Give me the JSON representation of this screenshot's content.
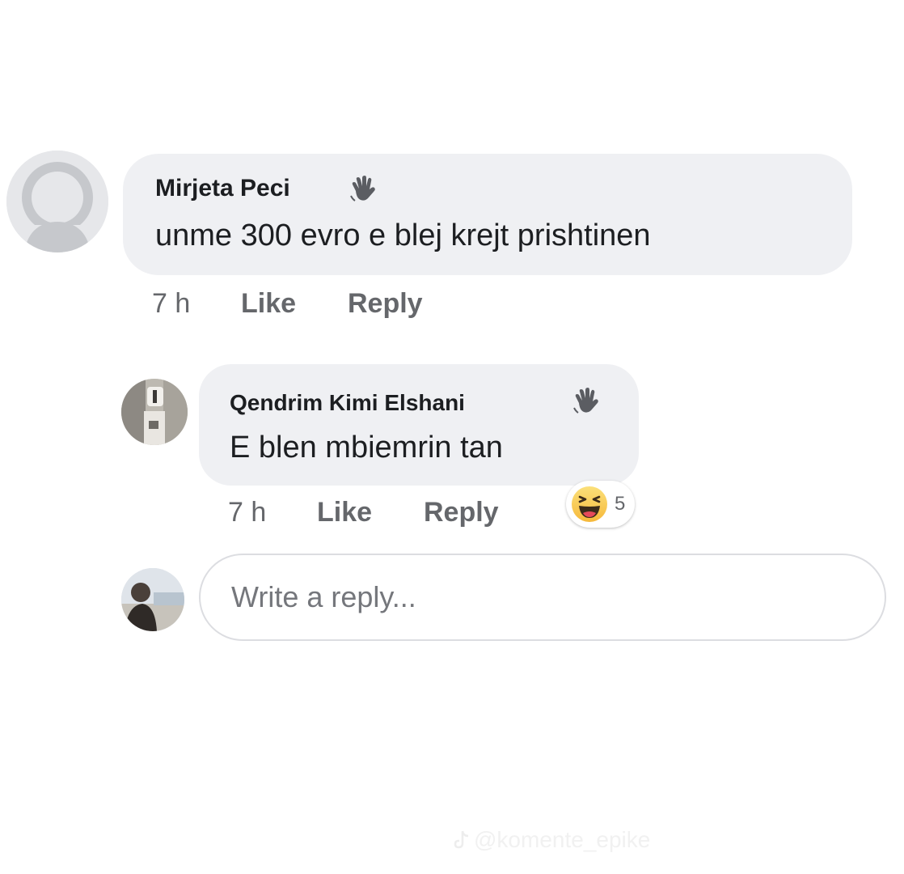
{
  "comments": [
    {
      "author": "Mirjeta Peci",
      "text": "unme 300 evro e blej krejt prishtinen",
      "time": "7 h",
      "like_label": "Like",
      "reply_label": "Reply",
      "badge_icon": "waving-hand-icon"
    },
    {
      "author": "Qendrim Kimi Elshani",
      "text": "E blen mbiemrin tan",
      "time": "7 h",
      "like_label": "Like",
      "reply_label": "Reply",
      "badge_icon": "waving-hand-icon",
      "reaction": {
        "icon": "haha-emoji-icon",
        "count": "5"
      }
    }
  ],
  "composer": {
    "placeholder": "Write a reply..."
  },
  "watermark": {
    "icon": "tiktok-icon",
    "text": "@komente_epike"
  },
  "colors": {
    "bubble": "#eff0f3",
    "meta_text": "#65676b",
    "main_text": "#1c1e21"
  }
}
